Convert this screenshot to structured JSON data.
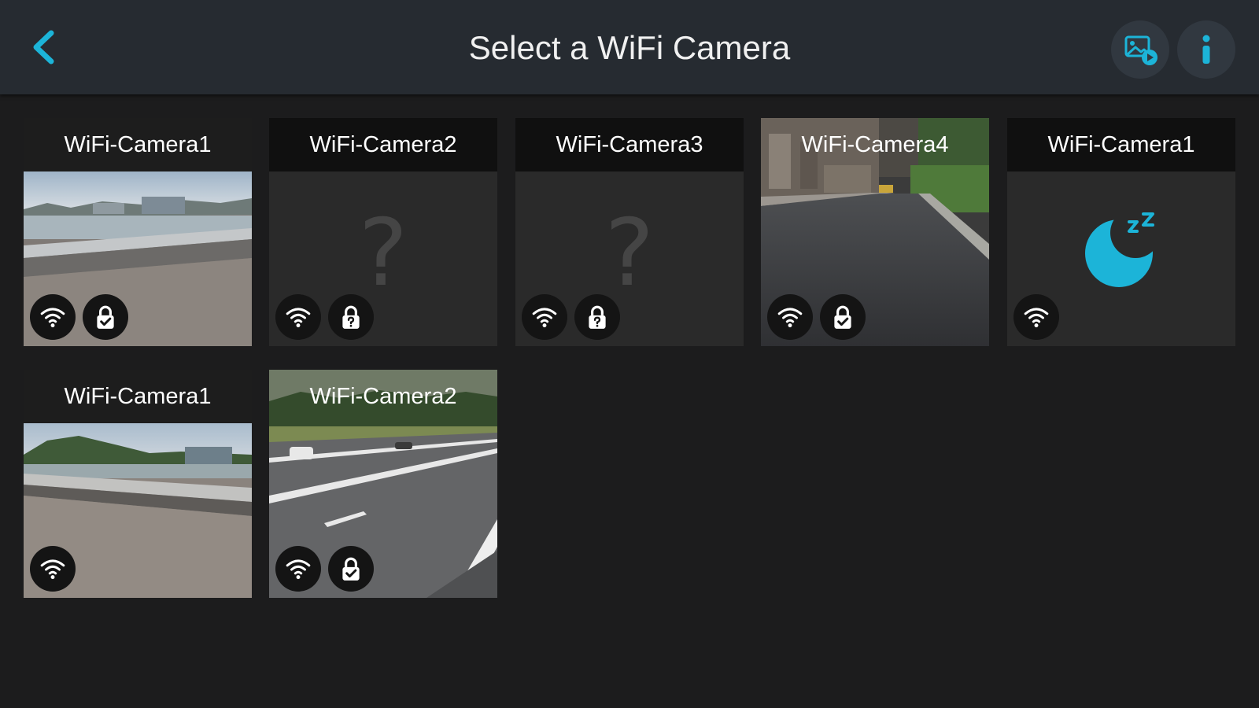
{
  "header": {
    "title": "Select a WiFi Camera",
    "back_icon": "chevron-left-icon",
    "gallery_icon": "media-gallery-icon",
    "info_icon": "info-icon"
  },
  "colors": {
    "accent": "#1cb4d8",
    "topbar": "#262b31",
    "background": "#1c1c1d"
  },
  "cameras": [
    {
      "name": "WiFi-Camera1",
      "preview": "lake-road-photo",
      "wifi": true,
      "lock": "unlocked"
    },
    {
      "name": "WiFi-Camera2",
      "preview": "unknown",
      "wifi": true,
      "lock": "unknown"
    },
    {
      "name": "WiFi-Camera3",
      "preview": "unknown",
      "wifi": true,
      "lock": "unknown"
    },
    {
      "name": "WiFi-Camera4",
      "preview": "street-road-photo",
      "wifi": true,
      "lock": "unlocked"
    },
    {
      "name": "WiFi-Camera1",
      "preview": "sleeping",
      "wifi": true,
      "lock": "none"
    },
    {
      "name": "WiFi-Camera1",
      "preview": "hills-road-photo",
      "wifi": true,
      "lock": "none"
    },
    {
      "name": "WiFi-Camera2",
      "preview": "highway-photo",
      "wifi": true,
      "lock": "unlocked"
    }
  ]
}
